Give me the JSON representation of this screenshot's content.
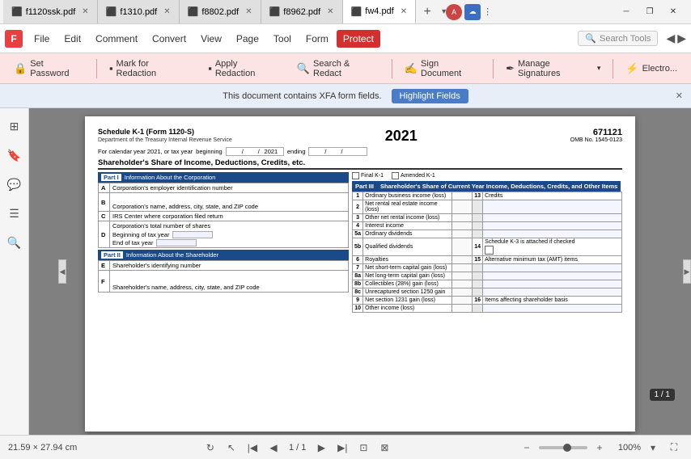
{
  "titlebar": {
    "tabs": [
      {
        "id": "tab1",
        "label": "f1120ssk.pdf",
        "active": false
      },
      {
        "id": "tab2",
        "label": "f1310.pdf",
        "active": false
      },
      {
        "id": "tab3",
        "label": "f8802.pdf",
        "active": false
      },
      {
        "id": "tab4",
        "label": "f8962.pdf",
        "active": false
      },
      {
        "id": "tab5",
        "label": "fw4.pdf",
        "active": true
      }
    ],
    "new_tab_icon": "+",
    "minimize_icon": "─",
    "restore_icon": "❐",
    "close_icon": "✕"
  },
  "menubar": {
    "logo": "F",
    "items": [
      {
        "id": "file",
        "label": "File",
        "active": false
      },
      {
        "id": "edit",
        "label": "Edit",
        "active": false
      },
      {
        "id": "comment",
        "label": "Comment",
        "active": false
      },
      {
        "id": "convert",
        "label": "Convert",
        "active": false
      },
      {
        "id": "view",
        "label": "View",
        "active": false
      },
      {
        "id": "page",
        "label": "Page",
        "active": false
      },
      {
        "id": "tool",
        "label": "Tool",
        "active": false
      },
      {
        "id": "form",
        "label": "Form",
        "active": false
      },
      {
        "id": "protect",
        "label": "Protect",
        "active": true
      }
    ],
    "search_placeholder": "Search Tools"
  },
  "toolbar": {
    "buttons": [
      {
        "id": "set-password",
        "icon": "🔒",
        "label": "Set Password"
      },
      {
        "id": "mark-redaction",
        "icon": "▪",
        "label": "Mark for Redaction"
      },
      {
        "id": "apply-redaction",
        "icon": "▪",
        "label": "Apply Redaction"
      },
      {
        "id": "search-redact",
        "icon": "🔍",
        "label": "Search & Redact"
      },
      {
        "id": "sign-doc",
        "icon": "✍",
        "label": "Sign Document"
      },
      {
        "id": "manage-sig",
        "icon": "✒",
        "label": "Manage Signatures"
      },
      {
        "id": "electronic",
        "icon": "⚡",
        "label": "Electro..."
      }
    ]
  },
  "xfa_bar": {
    "message": "This document contains XFA form fields.",
    "button_label": "Highlight Fields",
    "close_icon": "✕"
  },
  "sidebar": {
    "icons": [
      {
        "id": "pages",
        "icon": "⊞",
        "label": "Pages Panel"
      },
      {
        "id": "bookmarks",
        "icon": "🔖",
        "label": "Bookmarks"
      },
      {
        "id": "comments",
        "icon": "💬",
        "label": "Comments"
      },
      {
        "id": "layers",
        "icon": "☰",
        "label": "Layers"
      },
      {
        "id": "search",
        "icon": "🔍",
        "label": "Search"
      }
    ]
  },
  "pdf": {
    "id_number": "671121",
    "omb": "OMB No. 1545-0123",
    "schedule_title": "Schedule K-1  (Form 1120-S)",
    "year": "2021",
    "dept": "Department of the Treasury  Internal Revenue Service",
    "tax_year_label": "For calendar year 2021, or tax year",
    "beginning_label": "beginning",
    "slash1": "/",
    "slash2": "/",
    "ending_label": "ending",
    "shareholder_title": "Shareholder's Share of Income, Deductions, Credits, etc.",
    "part1_label": "Part I",
    "part1_title": "Information About the Corporation",
    "part2_label": "Part II",
    "part2_title": "Information About the Shareholder",
    "part3_label": "Part III",
    "part3_title": "Shareholder's Share of Current Year Income,  Deductions, Credits, and Other Items",
    "final_k1": "Final K-1",
    "amended_k1": "Amended K-1",
    "rows_left": [
      {
        "id": "A",
        "label": "Corporation's employer identification number"
      },
      {
        "id": "B",
        "label": "Corporation's name, address, city, state, and ZIP code"
      },
      {
        "id": "C",
        "label": "IRS Center where corporation filed return"
      },
      {
        "id": "D",
        "label": "Corporation's total number of shares"
      },
      {
        "id": "D1",
        "label": "Beginning of tax year"
      },
      {
        "id": "D2",
        "label": "End of tax year"
      }
    ],
    "rows_left_part2": [
      {
        "id": "E",
        "label": "Shareholder's identifying number"
      },
      {
        "id": "F",
        "label": "Shareholder's name, address, city, state, and ZIP code"
      }
    ],
    "rows_right": [
      {
        "num": "1",
        "label": "Ordinary business income (loss)",
        "col2": "13",
        "col3": "Credits"
      },
      {
        "num": "2",
        "label": "Net rental real estate income (loss)",
        "col2": "",
        "col3": ""
      },
      {
        "num": "3",
        "label": "Other net rental income (loss)",
        "col2": "",
        "col3": ""
      },
      {
        "num": "4",
        "label": "Interest income",
        "col2": "",
        "col3": ""
      },
      {
        "num": "5a",
        "label": "Ordinary dividends",
        "col2": "",
        "col3": ""
      },
      {
        "num": "5b",
        "label": "Qualified dividends",
        "col2": "14",
        "col3": "Schedule K-3 is attached if checked"
      },
      {
        "num": "6",
        "label": "Royalties",
        "col2": "15",
        "col3": "Alternative minimum tax (AMT) items"
      },
      {
        "num": "7",
        "label": "Net short-term capital gain (loss)",
        "col2": "",
        "col3": ""
      },
      {
        "num": "8a",
        "label": "Net long-term capital gain (loss)",
        "col2": "",
        "col3": ""
      },
      {
        "num": "8b",
        "label": "Collectibles (28%) gain (loss)",
        "col2": "",
        "col3": ""
      },
      {
        "num": "8c",
        "label": "Unrecaptured section 1250 gain",
        "col2": "",
        "col3": ""
      },
      {
        "num": "9",
        "label": "Net section 1231 gain (loss)",
        "col2": "16",
        "col3": "Items affecting shareholder basis"
      },
      {
        "num": "10",
        "label": "Other income (loss)",
        "col2": "",
        "col3": ""
      }
    ]
  },
  "bottom_bar": {
    "dimensions": "21.59 × 27.94 cm",
    "page_current": "1",
    "page_total": "1",
    "page_display": "1 / 1",
    "zoom_percent": "100%",
    "page_badge": "1 / 1"
  }
}
